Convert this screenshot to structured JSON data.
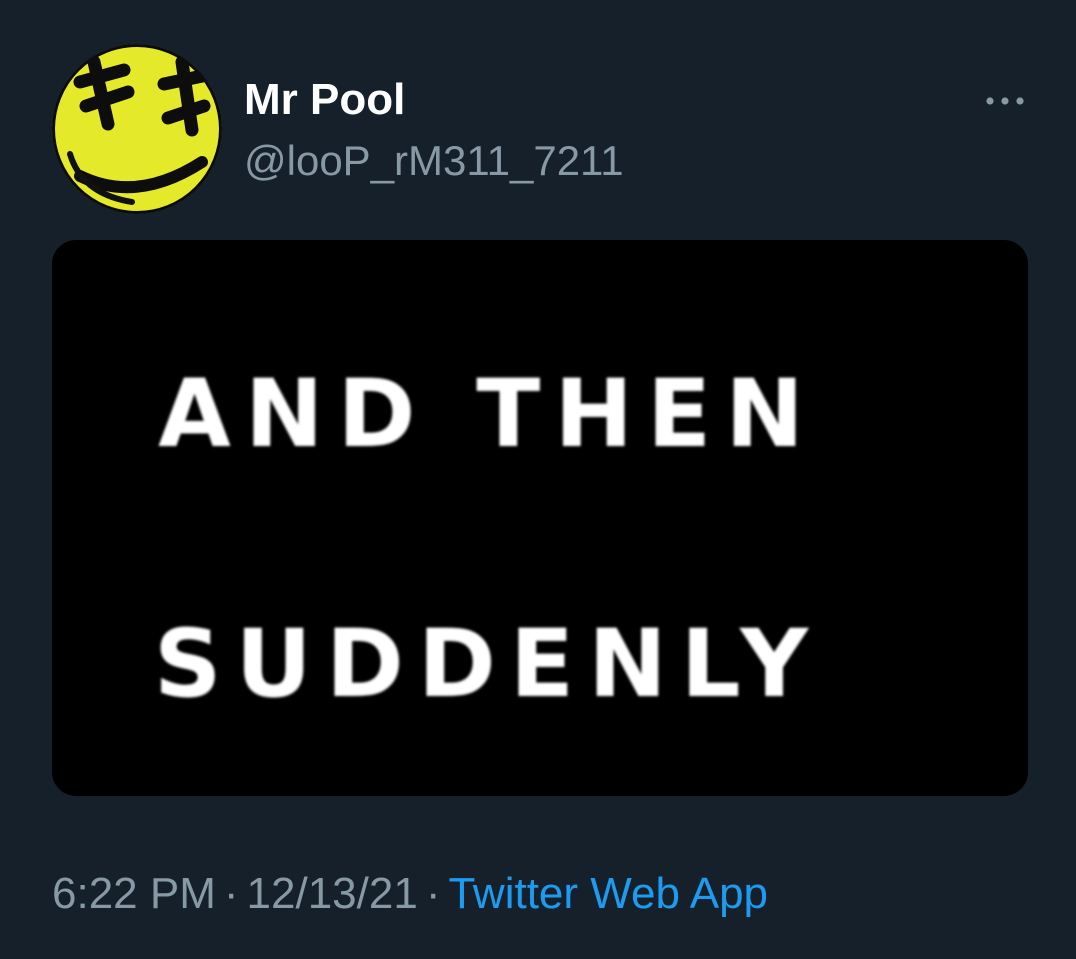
{
  "tweet": {
    "author": {
      "display_name": "Mr Pool",
      "handle": "@looP_rM311_7211",
      "avatar_icon": "yellow-smiley-icon"
    },
    "more_icon": "more-horizontal-icon",
    "media": {
      "line1": "AND THEN",
      "line2": "SUDDENLY"
    },
    "meta": {
      "time": "6:22 PM",
      "separator": "·",
      "date": "12/13/21",
      "source": "Twitter Web App"
    }
  },
  "colors": {
    "background": "#15202b",
    "text_primary": "#ffffff",
    "text_secondary": "#8899a6",
    "link": "#1d9bf0",
    "avatar_yellow": "#e6ec2a"
  }
}
